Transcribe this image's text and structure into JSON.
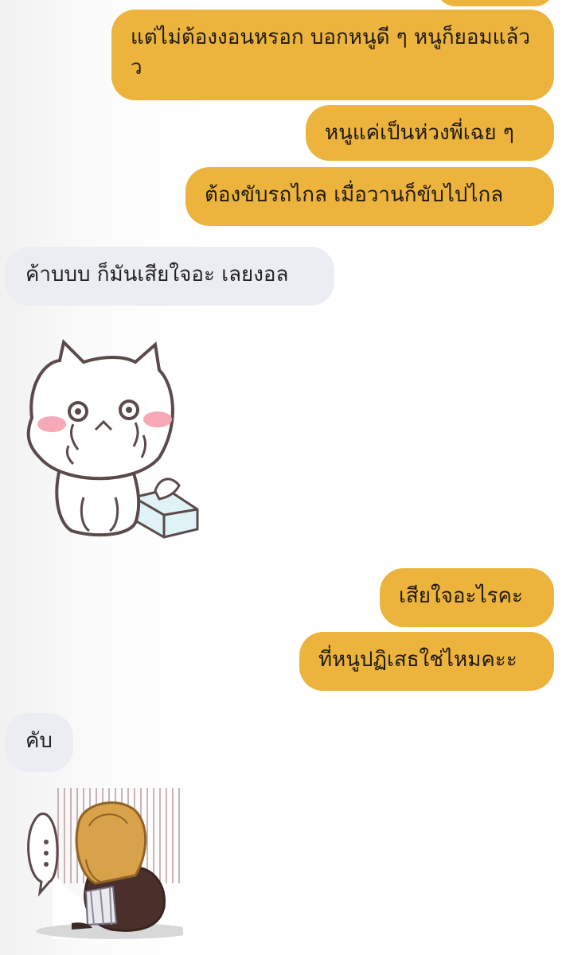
{
  "colors": {
    "outgoing_bubble": "#ecb33d",
    "incoming_bubble": "#ebedf2"
  },
  "messages": [
    {
      "id": "m1",
      "side": "out",
      "text": "แต่ไม่ต้องงอนหรอก บอกหนูดี ๆ หนูก็ยอมแล้วว"
    },
    {
      "id": "m2",
      "side": "out",
      "text": "หนูแค่เป็นห่วงพี่เฉย ๆ"
    },
    {
      "id": "m3",
      "side": "out",
      "text": "ต้องขับรถไกล เมื่อวานก็ขับไปไกล"
    },
    {
      "id": "m4",
      "side": "in",
      "text": "ค้าบบบ ก็มันเสียใจอะ เลยงอล"
    },
    {
      "id": "m5",
      "side": "in",
      "sticker": "crying-cat-sticker"
    },
    {
      "id": "m6",
      "side": "out",
      "text": "เสียใจอะไรคะ"
    },
    {
      "id": "m7",
      "side": "out",
      "text": "ที่หนูปฏิเสธใช่ไหมคะะ"
    },
    {
      "id": "m8",
      "side": "in",
      "text": "คับ"
    },
    {
      "id": "m9",
      "side": "in",
      "sticker": "sad-girl-sticker"
    }
  ]
}
